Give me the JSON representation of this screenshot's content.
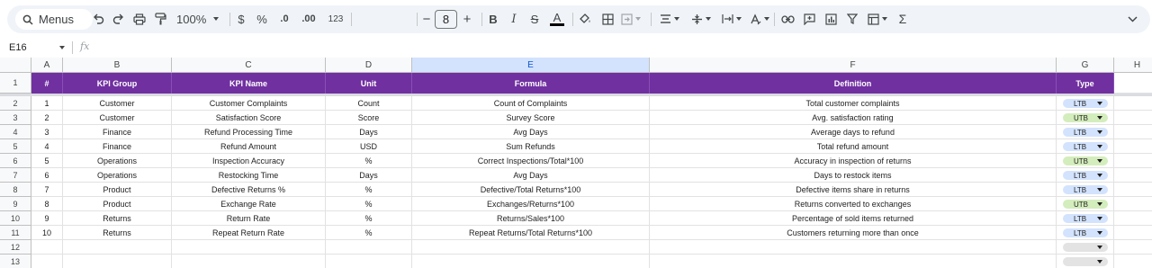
{
  "toolbar": {
    "menus_label": "Menus",
    "zoom": "100%",
    "currency": "$",
    "percent": "%",
    "dec_decrease": ".0",
    "dec_increase": ".00",
    "number_format": "123",
    "font_size": "8",
    "minus": "−",
    "plus": "+",
    "bold": "B",
    "italic": "I",
    "strike": "S",
    "text_color": "A",
    "sigma": "Σ"
  },
  "formula_bar": {
    "cell_ref": "E16",
    "fx": "fx"
  },
  "grid": {
    "columns": [
      "A",
      "B",
      "C",
      "D",
      "E",
      "F",
      "G",
      "H"
    ],
    "selected_column": "E",
    "row_numbers": [
      "1",
      "2",
      "3",
      "4",
      "5",
      "6",
      "7",
      "8",
      "9",
      "10",
      "11",
      "12",
      "13"
    ],
    "header_row": [
      "#",
      "KPI Group",
      "KPI Name",
      "Unit",
      "Formula",
      "Definition",
      "Type"
    ],
    "rows": [
      {
        "n": "1",
        "group": "Customer",
        "name": "Customer Complaints",
        "unit": "Count",
        "formula": "Count of Complaints",
        "definition": "Total customer complaints",
        "type": "LTB"
      },
      {
        "n": "2",
        "group": "Customer",
        "name": "Satisfaction Score",
        "unit": "Score",
        "formula": "Survey Score",
        "definition": "Avg. satisfaction rating",
        "type": "UTB"
      },
      {
        "n": "3",
        "group": "Finance",
        "name": "Refund Processing Time",
        "unit": "Days",
        "formula": "Avg Days",
        "definition": "Average days to refund",
        "type": "LTB"
      },
      {
        "n": "4",
        "group": "Finance",
        "name": "Refund Amount",
        "unit": "USD",
        "formula": "Sum Refunds",
        "definition": "Total refund amount",
        "type": "LTB"
      },
      {
        "n": "5",
        "group": "Operations",
        "name": "Inspection Accuracy",
        "unit": "%",
        "formula": "Correct Inspections/Total*100",
        "definition": "Accuracy in inspection of returns",
        "type": "UTB"
      },
      {
        "n": "6",
        "group": "Operations",
        "name": "Restocking Time",
        "unit": "Days",
        "formula": "Avg Days",
        "definition": "Days to restock items",
        "type": "LTB"
      },
      {
        "n": "7",
        "group": "Product",
        "name": "Defective Returns %",
        "unit": "%",
        "formula": "Defective/Total Returns*100",
        "definition": "Defective items share in returns",
        "type": "LTB"
      },
      {
        "n": "8",
        "group": "Product",
        "name": "Exchange Rate",
        "unit": "%",
        "formula": "Exchanges/Returns*100",
        "definition": "Returns converted to exchanges",
        "type": "UTB"
      },
      {
        "n": "9",
        "group": "Returns",
        "name": "Return Rate",
        "unit": "%",
        "formula": "Returns/Sales*100",
        "definition": "Percentage of sold items returned",
        "type": "LTB"
      },
      {
        "n": "10",
        "group": "Returns",
        "name": "Repeat Return Rate",
        "unit": "%",
        "formula": "Repeat Returns/Total Returns*100",
        "definition": "Customers returning more than once",
        "type": "LTB"
      },
      {
        "n": "",
        "group": "",
        "name": "",
        "unit": "",
        "formula": "",
        "definition": "",
        "type": ""
      },
      {
        "n": "",
        "group": "",
        "name": "",
        "unit": "",
        "formula": "",
        "definition": "",
        "type": ""
      }
    ]
  },
  "colors": {
    "header_bg": "#7030a0",
    "ltb_chip": "#d3e3fd",
    "utb_chip": "#d4edbc",
    "empty_chip": "#e3e3e3"
  }
}
